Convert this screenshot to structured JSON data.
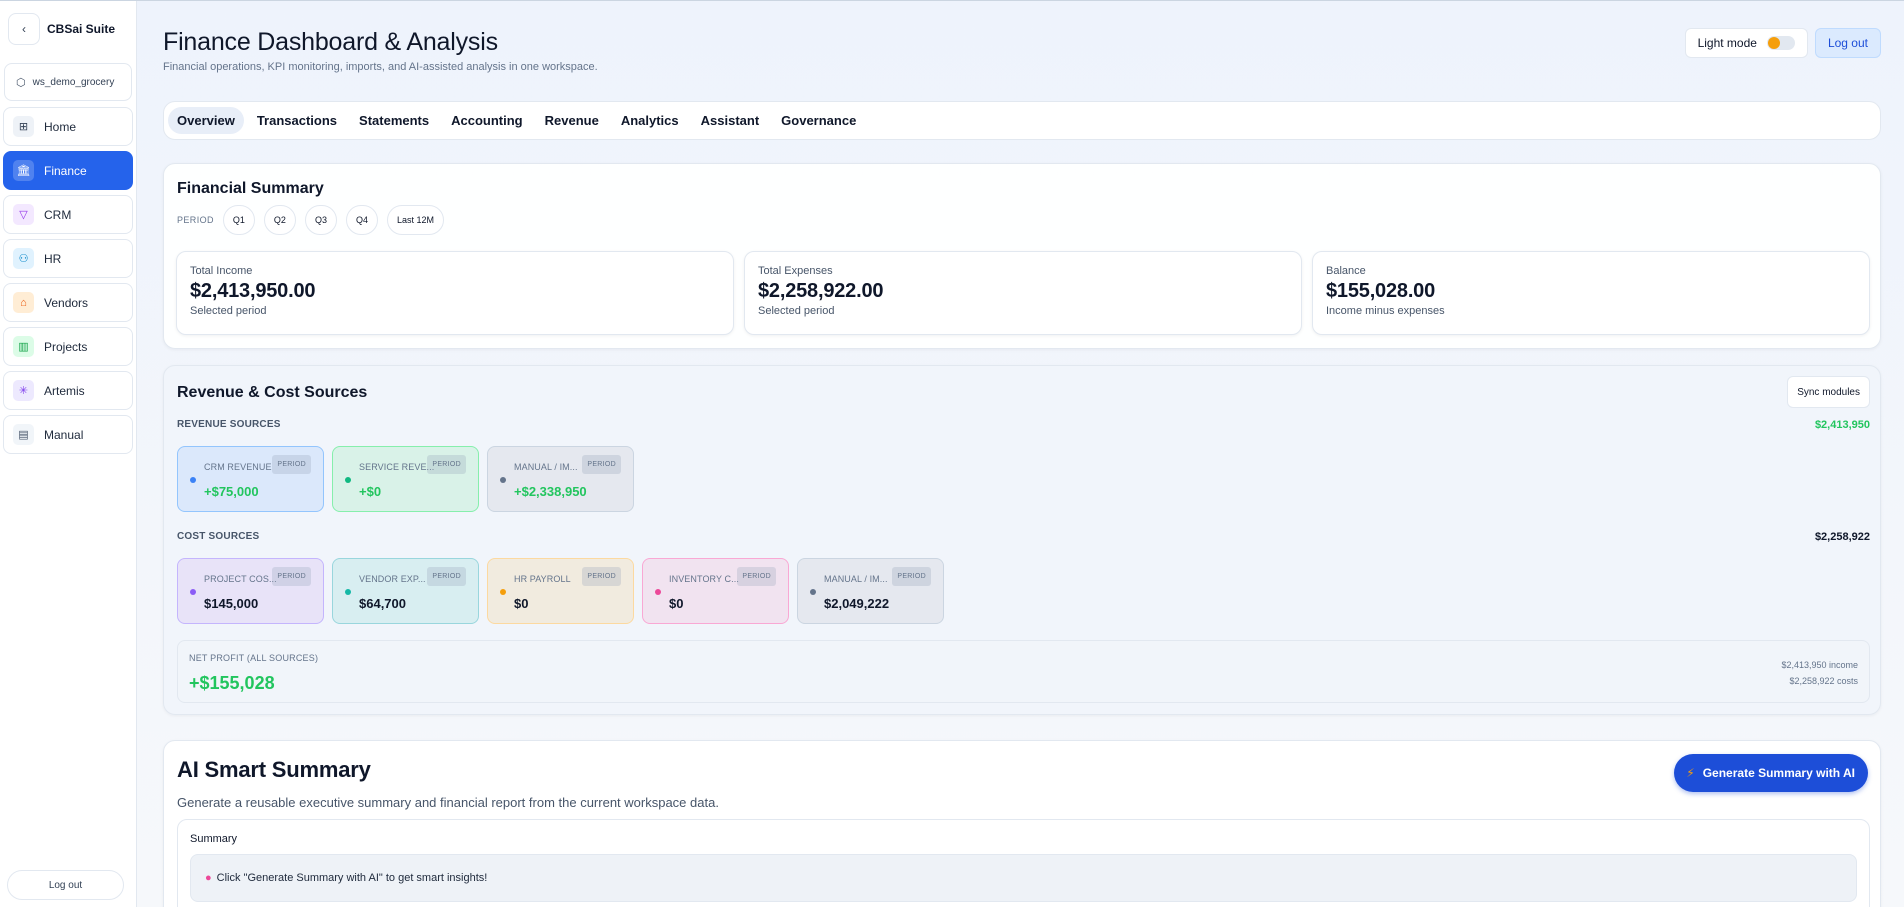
{
  "app": {
    "name": "CBSai Suite",
    "back_icon": "‹"
  },
  "workspace": {
    "name": "ws_demo_grocery"
  },
  "sidebar": {
    "items": [
      {
        "label": "Home",
        "icon": "⊞",
        "icon_bg": "#eef2f7",
        "icon_color": "#334155"
      },
      {
        "label": "Finance",
        "icon": "🏛",
        "icon_bg": "#dbeafe",
        "icon_color": "#1d4ed8"
      },
      {
        "label": "CRM",
        "icon": "▽",
        "icon_bg": "#f3e8ff",
        "icon_color": "#9333ea"
      },
      {
        "label": "HR",
        "icon": "⚇",
        "icon_bg": "#e0f2fe",
        "icon_color": "#0284c7"
      },
      {
        "label": "Vendors",
        "icon": "⌂",
        "icon_bg": "#ffedd5",
        "icon_color": "#ea580c"
      },
      {
        "label": "Projects",
        "icon": "▥",
        "icon_bg": "#dcfce7",
        "icon_color": "#16a34a"
      },
      {
        "label": "Artemis",
        "icon": "✳",
        "icon_bg": "#ede9fe",
        "icon_color": "#7c3aed"
      },
      {
        "label": "Manual",
        "icon": "▤",
        "icon_bg": "#f1f5f9",
        "icon_color": "#475569"
      }
    ],
    "active_index": 1,
    "logout": "Log out"
  },
  "header": {
    "title": "Finance Dashboard & Analysis",
    "subtitle": "Financial operations, KPI monitoring, imports, and AI-assisted analysis in one workspace.",
    "light_mode": "Light mode",
    "logout": "Log out"
  },
  "tabs": [
    "Overview",
    "Transactions",
    "Statements",
    "Accounting",
    "Revenue",
    "Analytics",
    "Assistant",
    "Governance"
  ],
  "financial_summary": {
    "title": "Financial Summary",
    "period_label": "PERIOD",
    "periods": [
      "Q1",
      "Q2",
      "Q3",
      "Q4",
      "Last 12M"
    ],
    "kpis": [
      {
        "label": "Total Income",
        "value": "$2,413,950.00",
        "note": "Selected period"
      },
      {
        "label": "Total Expenses",
        "value": "$2,258,922.00",
        "note": "Selected period"
      },
      {
        "label": "Balance",
        "value": "$155,028.00",
        "note": "Income minus expenses"
      }
    ]
  },
  "sources": {
    "title": "Revenue & Cost Sources",
    "sync_label": "Sync modules",
    "revenue_label": "REVENUE SOURCES",
    "revenue_total": "$2,413,950",
    "revenue": [
      {
        "name": "CRM REVENUE",
        "badge": "PERIOD",
        "value": "+$75,000",
        "bg": "#dbe8fb",
        "border": "#93c5fd",
        "dot": "#3b82f6",
        "val_color": "#22c55e"
      },
      {
        "name": "SERVICE REVE...",
        "badge": "PERIOD",
        "value": "+$0",
        "bg": "#d9f2e8",
        "border": "#86efac",
        "dot": "#10b981",
        "val_color": "#22c55e"
      },
      {
        "name": "MANUAL / IM...",
        "badge": "PERIOD",
        "value": "+$2,338,950",
        "bg": "#e5e8ef",
        "border": "#cbd5e1",
        "dot": "#64748b",
        "val_color": "#22c55e"
      }
    ],
    "cost_label": "COST SOURCES",
    "cost_total": "$2,258,922",
    "costs": [
      {
        "name": "PROJECT COS...",
        "badge": "PERIOD",
        "value": "$145,000",
        "bg": "#e8e3f8",
        "border": "#c4b5fd",
        "dot": "#8b5cf6",
        "val_color": "#0f172a"
      },
      {
        "name": "VENDOR EXP...",
        "badge": "PERIOD",
        "value": "$64,700",
        "bg": "#d8eef1",
        "border": "#99d6dd",
        "dot": "#14b8a6",
        "val_color": "#0f172a"
      },
      {
        "name": "HR PAYROLL",
        "badge": "PERIOD",
        "value": "$0",
        "bg": "#f1ebdf",
        "border": "#fcd9a0",
        "dot": "#f59e0b",
        "val_color": "#0f172a"
      },
      {
        "name": "INVENTORY C...",
        "badge": "PERIOD",
        "value": "$0",
        "bg": "#f1e3f0",
        "border": "#f9a8d4",
        "dot": "#ec4899",
        "val_color": "#0f172a"
      },
      {
        "name": "MANUAL / IM...",
        "badge": "PERIOD",
        "value": "$2,049,222",
        "bg": "#e5e8ef",
        "border": "#cbd5e1",
        "dot": "#64748b",
        "val_color": "#0f172a"
      }
    ],
    "net_label": "NET PROFIT (ALL SOURCES)",
    "net_value": "+$155,028",
    "net_income": "$2,413,950 income",
    "net_costs": "$2,258,922 costs"
  },
  "ai": {
    "title": "AI Smart Summary",
    "subtitle": "Generate a reusable executive summary and financial report from the current workspace data.",
    "button": "Generate Summary with AI",
    "summary_label": "Summary",
    "placeholder": "Click \"Generate Summary with AI\" to get smart insights!"
  }
}
